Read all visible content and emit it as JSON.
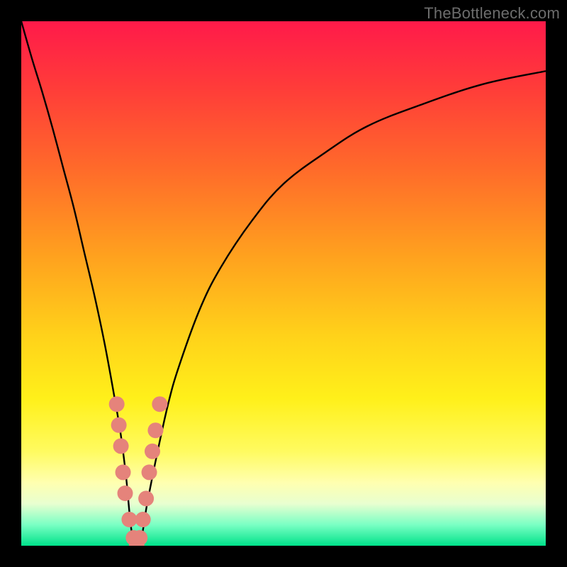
{
  "watermark": "TheBottleneck.com",
  "colors": {
    "frame": "#000000",
    "curve": "#000000",
    "marker_fill": "#e5837b",
    "gradient_top": "#ff1a4a",
    "gradient_bottom": "#00e28a"
  },
  "chart_data": {
    "type": "line",
    "title": "",
    "xlabel": "",
    "ylabel": "",
    "xlim": [
      0,
      100
    ],
    "ylim": [
      0,
      100
    ],
    "grid": false,
    "legend": "none",
    "annotations": [
      "TheBottleneck.com"
    ],
    "series": [
      {
        "name": "bottleneck-curve",
        "x": [
          0,
          2,
          4,
          6,
          8,
          10,
          12,
          14,
          16,
          18,
          19,
          20,
          21,
          22,
          23,
          24,
          26,
          28,
          30,
          34,
          38,
          44,
          50,
          58,
          66,
          76,
          88,
          100
        ],
        "y": [
          100,
          93,
          86.5,
          79.5,
          72,
          64.5,
          56,
          47.5,
          38,
          27,
          21,
          13,
          3,
          0,
          2,
          8,
          18,
          27,
          34,
          45,
          53,
          62,
          69,
          75,
          80,
          84,
          88,
          90.5
        ]
      }
    ],
    "markers": [
      {
        "x": 18.2,
        "y": 27
      },
      {
        "x": 18.6,
        "y": 23
      },
      {
        "x": 19.0,
        "y": 19
      },
      {
        "x": 19.4,
        "y": 14
      },
      {
        "x": 19.8,
        "y": 10
      },
      {
        "x": 20.6,
        "y": 5
      },
      {
        "x": 21.4,
        "y": 1.5
      },
      {
        "x": 22.0,
        "y": 0
      },
      {
        "x": 22.6,
        "y": 1.5
      },
      {
        "x": 23.2,
        "y": 5
      },
      {
        "x": 23.8,
        "y": 9
      },
      {
        "x": 24.4,
        "y": 14
      },
      {
        "x": 25.0,
        "y": 18
      },
      {
        "x": 25.6,
        "y": 22
      },
      {
        "x": 26.4,
        "y": 27
      }
    ]
  }
}
